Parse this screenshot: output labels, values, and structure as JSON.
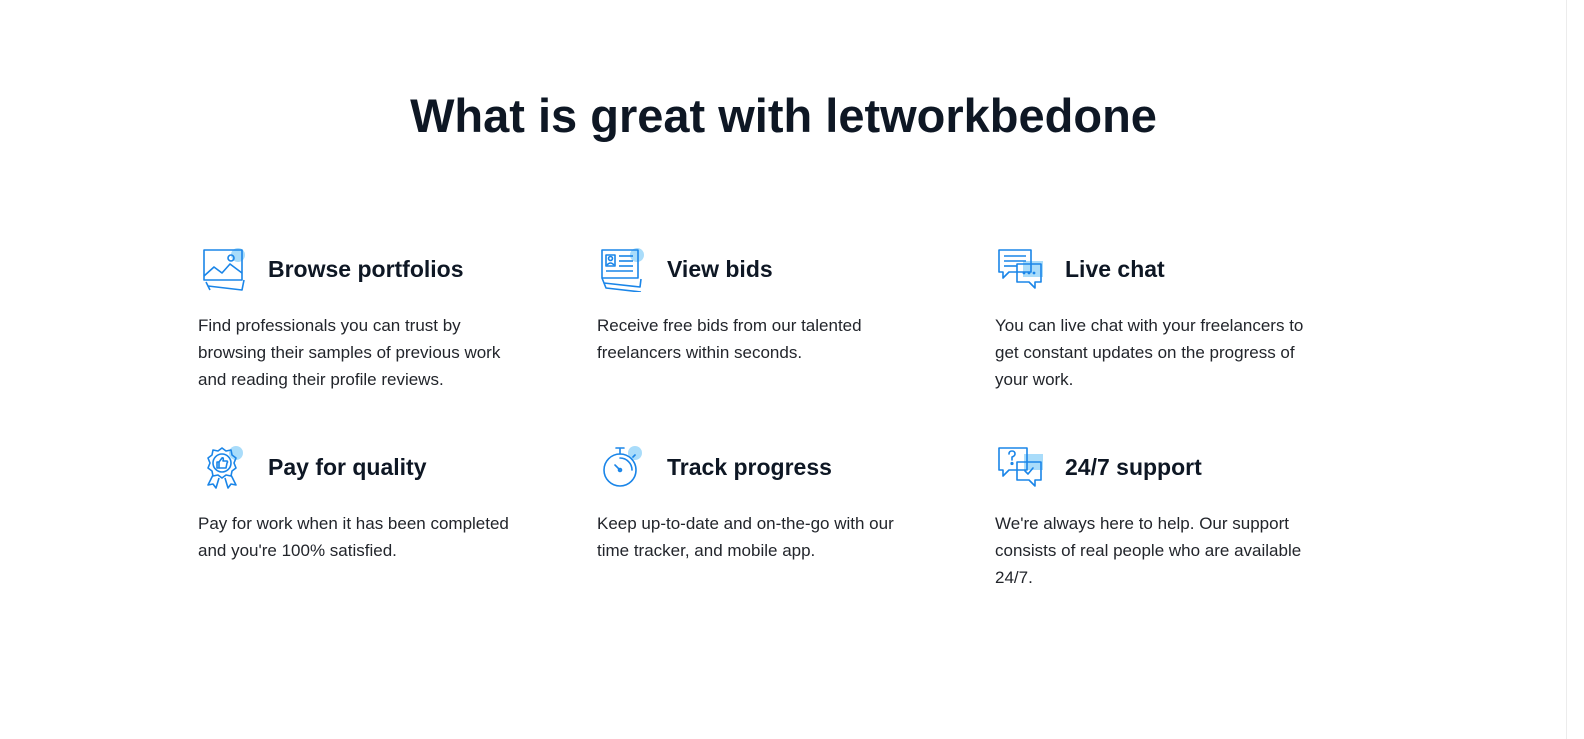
{
  "section": {
    "title": "What is great with letworkbedone"
  },
  "features": [
    {
      "icon": "portfolio-images-icon",
      "title": "Browse portfolios",
      "description": "Find professionals you can trust by browsing their samples of previous work and reading their profile reviews."
    },
    {
      "icon": "id-card-bids-icon",
      "title": "View bids",
      "description": "Receive free bids from our talented freelancers within seconds."
    },
    {
      "icon": "chat-bubbles-icon",
      "title": "Live chat",
      "description": "You can live chat with your freelancers to get constant updates on the progress of your work."
    },
    {
      "icon": "quality-badge-icon",
      "title": "Pay for quality",
      "description": "Pay for work when it has been completed and you're 100% satisfied."
    },
    {
      "icon": "stopwatch-icon",
      "title": "Track progress",
      "description": "Keep up-to-date and on-the-go with our time tracker, and mobile app."
    },
    {
      "icon": "support-question-icon",
      "title": "24/7 support",
      "description": "We're always here to help. Our support consists of real people who are available 24/7."
    }
  ],
  "colors": {
    "icon_stroke": "#1a85e8",
    "icon_accent": "#a9dcfa",
    "heading": "#0e1724",
    "body_text": "#22252b"
  }
}
